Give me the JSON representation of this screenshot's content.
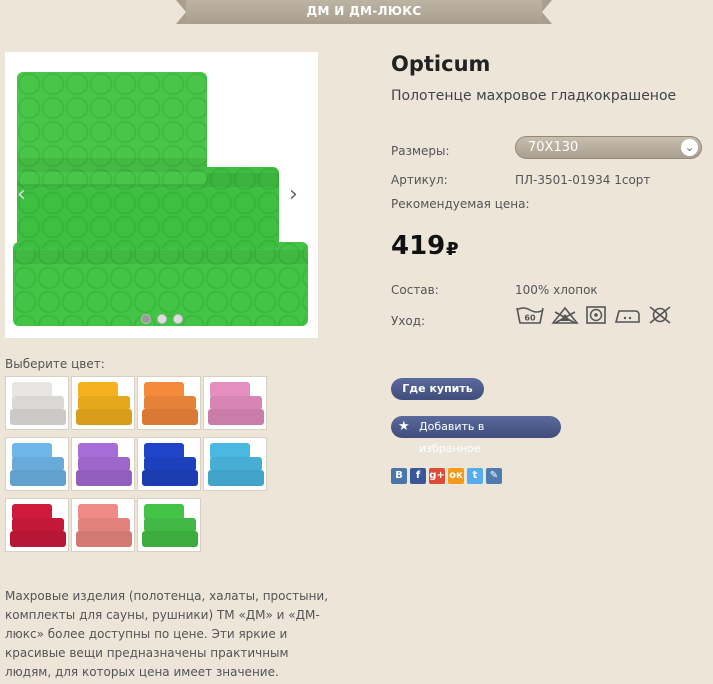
{
  "ribbon": {
    "text": "ДМ И ДМ-ЛЮКС"
  },
  "gallery": {
    "prev_arrow": "‹",
    "next_arrow": "›",
    "slides": 3,
    "active_slide": 1
  },
  "colors": {
    "label": "Выберите цвет:",
    "swatches": [
      {
        "name": "white",
        "color": "#e8e6e3"
      },
      {
        "name": "yellow",
        "color": "#f5b21e"
      },
      {
        "name": "orange",
        "color": "#f58a3c"
      },
      {
        "name": "pink",
        "color": "#e58ec0"
      },
      {
        "name": "light-blue",
        "color": "#6fb6e9"
      },
      {
        "name": "violet",
        "color": "#a66cd8"
      },
      {
        "name": "blue",
        "color": "#1f44c9"
      },
      {
        "name": "turquoise",
        "color": "#4ab9e2"
      },
      {
        "name": "crimson",
        "color": "#d01a3c"
      },
      {
        "name": "salmon",
        "color": "#f08a84"
      },
      {
        "name": "green",
        "color": "#44c447"
      }
    ]
  },
  "description": "Махровые изделия (полотенца, халаты, простыни, комплекты для сауны, рушники) ТМ «ДМ» и «ДМ-люкс» более доступны по цене. Эти яркие и красивые вещи предназначены практичным людям, для которых цена имеет значение.",
  "product": {
    "title": "Opticum",
    "subtitle": "Полотенце махровое гладкокрашеное",
    "sizes_label": "Размеры:",
    "size_selected": "70Х130",
    "article_label": "Артикул:",
    "article_value": "ПЛ-3501-01934 1сорт",
    "recommended_price_label": "Рекомендуемая цена:",
    "price": "419",
    "currency": "₽",
    "composition_label": "Состав:",
    "composition_value": "100% хлопок",
    "care_label": "Уход:",
    "care_icons": [
      "wash-60-icon",
      "bleach-icon",
      "tumble-dry-icon",
      "iron-icon",
      "no-dry-clean-icon"
    ],
    "wash_temp": "60"
  },
  "actions": {
    "where_to_buy": "Где купить",
    "add_favorite": "Добавить в избранное"
  },
  "social": [
    {
      "name": "vkontakte-icon",
      "glyph": "B",
      "color": "#4a76a8"
    },
    {
      "name": "facebook-icon",
      "glyph": "f",
      "color": "#3b5998"
    },
    {
      "name": "google-plus-icon",
      "glyph": "g+",
      "color": "#dd4b39"
    },
    {
      "name": "odnoklassniki-icon",
      "glyph": "ок",
      "color": "#f59a1a"
    },
    {
      "name": "twitter-icon",
      "glyph": "t",
      "color": "#55acee"
    },
    {
      "name": "livejournal-icon",
      "glyph": "✎",
      "color": "#4f7cae"
    }
  ]
}
